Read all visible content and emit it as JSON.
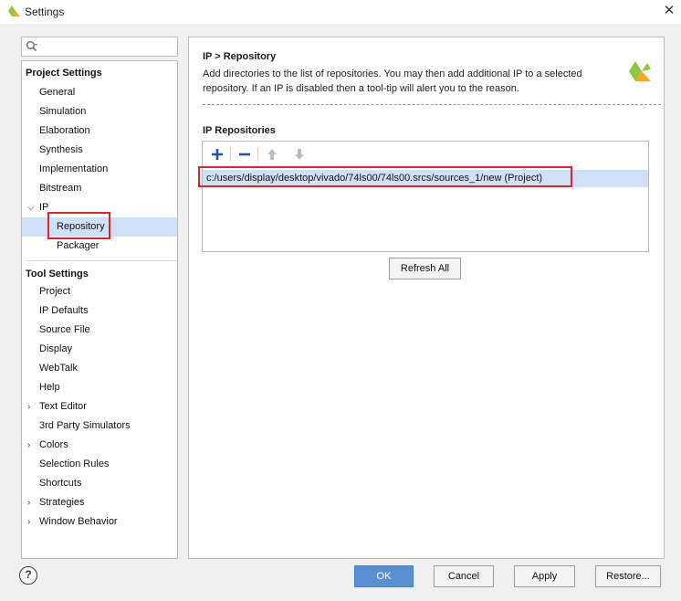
{
  "window": {
    "title": "Settings",
    "close_glyph": "✕"
  },
  "search": {
    "placeholder": "",
    "value": ""
  },
  "sidebar": {
    "project_settings_header": "Project Settings",
    "project_items": [
      "General",
      "Simulation",
      "Elaboration",
      "Synthesis",
      "Implementation",
      "Bitstream"
    ],
    "ip_label": "IP",
    "ip_children": [
      "Repository",
      "Packager"
    ],
    "tool_settings_header": "Tool Settings",
    "tool_items": [
      "Project",
      "IP Defaults",
      "Source File",
      "Display",
      "WebTalk",
      "Help",
      "Text Editor",
      "3rd Party Simulators",
      "Colors",
      "Selection Rules",
      "Shortcuts",
      "Strategies",
      "Window Behavior"
    ],
    "selected": "Repository"
  },
  "main": {
    "breadcrumb": "IP > Repository",
    "description_line1": "Add directories to the list of repositories. You may then add additional IP to a selected",
    "description_line2": "repository. If an IP is disabled then a tool-tip will alert you to the reason.",
    "section_title": "IP Repositories",
    "repositories": [
      "c:/users/display/desktop/vivado/74ls00/74ls00.srcs/sources_1/new (Project)"
    ],
    "refresh_label": "Refresh All"
  },
  "footer": {
    "help_glyph": "?",
    "ok_label": "OK",
    "cancel_label": "Cancel",
    "apply_label": "Apply",
    "restore_label": "Restore..."
  },
  "colors": {
    "selection": "#cfe0f7",
    "highlight": "#d9272e",
    "ok_button": "#5b8fd4",
    "logo_green": "#8dc63f",
    "logo_orange": "#f5a623"
  }
}
